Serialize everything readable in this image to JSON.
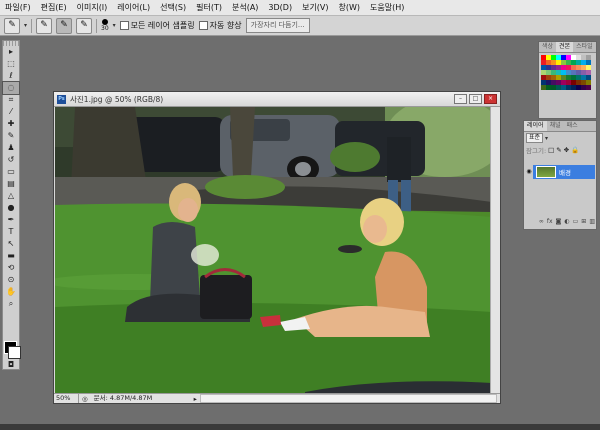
{
  "menubar": {
    "items": [
      "파일(F)",
      "편집(E)",
      "이미지(I)",
      "레이어(L)",
      "선택(S)",
      "필터(T)",
      "분석(A)",
      "3D(D)",
      "보기(V)",
      "창(W)",
      "도움말(H)"
    ]
  },
  "options": {
    "brush_size": "30",
    "sample_all_layers_label": "모든 레이어 샘플링",
    "auto_enhance_label": "자동 향상",
    "refine_edge_label": "가장자리 다듬기..."
  },
  "toolbox": {
    "tools": [
      {
        "name": "move-tool",
        "glyph": "▸"
      },
      {
        "name": "marquee-tool",
        "glyph": "⬚"
      },
      {
        "name": "lasso-tool",
        "glyph": "ℓ"
      },
      {
        "name": "quick-selection-tool",
        "glyph": "◌"
      },
      {
        "name": "crop-tool",
        "glyph": "⌗"
      },
      {
        "name": "eyedropper-tool",
        "glyph": "⁄"
      },
      {
        "name": "healing-brush-tool",
        "glyph": "✚"
      },
      {
        "name": "brush-tool",
        "glyph": "✎"
      },
      {
        "name": "clone-stamp-tool",
        "glyph": "♟"
      },
      {
        "name": "history-brush-tool",
        "glyph": "↺"
      },
      {
        "name": "eraser-tool",
        "glyph": "▭"
      },
      {
        "name": "gradient-tool",
        "glyph": "▤"
      },
      {
        "name": "blur-tool",
        "glyph": "△"
      },
      {
        "name": "dodge-tool",
        "glyph": "●"
      },
      {
        "name": "pen-tool",
        "glyph": "✒"
      },
      {
        "name": "type-tool",
        "glyph": "T"
      },
      {
        "name": "path-selection-tool",
        "glyph": "↖"
      },
      {
        "name": "shape-tool",
        "glyph": "▬"
      },
      {
        "name": "3d-rotate-tool",
        "glyph": "⟲"
      },
      {
        "name": "3d-orbit-tool",
        "glyph": "⊙"
      },
      {
        "name": "hand-tool",
        "glyph": "✋"
      },
      {
        "name": "zoom-tool",
        "glyph": "⌕"
      }
    ],
    "active_index": 3
  },
  "document": {
    "title": "사진1.jpg @ 50% (RGB/8)",
    "zoom": "50%",
    "doc_info": "문서: 4.87M/4.87M"
  },
  "swatches_panel": {
    "tabs": [
      "색상",
      "견본",
      "스타일"
    ],
    "active_tab": 1,
    "colors": [
      "#ff0000",
      "#ffff00",
      "#00ff00",
      "#00ffff",
      "#0000ff",
      "#ff00ff",
      "#ffffff",
      "#e0e0e0",
      "#c0c0c0",
      "#a0a0a0",
      "#ed1c24",
      "#f26522",
      "#f7941d",
      "#fff200",
      "#8dc63f",
      "#39b54a",
      "#00a651",
      "#00a99d",
      "#00aeef",
      "#0072bc",
      "#0054a6",
      "#2e3192",
      "#662d91",
      "#92278f",
      "#ec008c",
      "#ed145b",
      "#f26c4f",
      "#f68e56",
      "#fbaf5d",
      "#fff568",
      "#acd373",
      "#7cc576",
      "#3cb878",
      "#1cbbb4",
      "#00bff3",
      "#448ccb",
      "#5674b9",
      "#605ca8",
      "#855fa8",
      "#a763a8",
      "#9e0b0f",
      "#a0410d",
      "#a36209",
      "#aba000",
      "#598527",
      "#197b30",
      "#007236",
      "#00746b",
      "#0076a3",
      "#004b80",
      "#003471",
      "#1b1464",
      "#440e62",
      "#630460",
      "#9e005d",
      "#9e0039",
      "#790000",
      "#7b2e00",
      "#7d4900",
      "#827b00",
      "#406618",
      "#005e20",
      "#005826",
      "#005952",
      "#005b7f",
      "#003663",
      "#002157",
      "#0d004c",
      "#32004b",
      "#4b0049"
    ]
  },
  "layers_panel": {
    "tabs": [
      "레이어",
      "채널",
      "패스"
    ],
    "blend_mode": "표준",
    "lock_label": "잠그기:",
    "layer_name": "배경"
  }
}
